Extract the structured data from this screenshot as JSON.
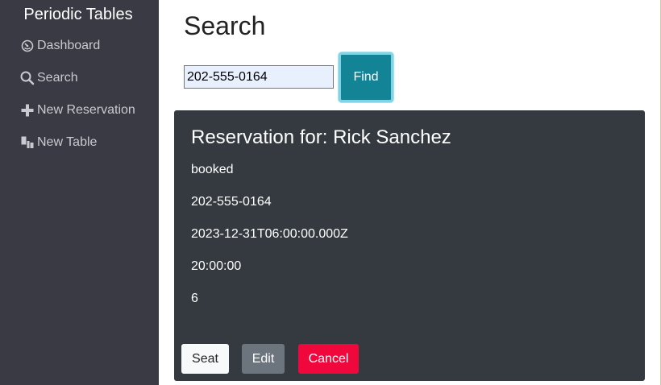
{
  "sidebar": {
    "brand": "Periodic Tables",
    "items": [
      {
        "label": "Dashboard",
        "icon": "dashboard-icon"
      },
      {
        "label": "Search",
        "icon": "search-icon"
      },
      {
        "label": "New Reservation",
        "icon": "plus-icon"
      },
      {
        "label": "New Table",
        "icon": "table-icon"
      }
    ]
  },
  "main": {
    "title": "Search",
    "search": {
      "value": "202-555-0164",
      "button_label": "Find"
    },
    "reservation": {
      "title": "Reservation for: Rick Sanchez",
      "status": "booked",
      "mobile_number": "202-555-0164",
      "date": "2023-12-31T06:00:00.000Z",
      "time": "20:00:00",
      "people": "6",
      "buttons": {
        "seat": "Seat",
        "edit": "Edit",
        "cancel": "Cancel"
      }
    }
  },
  "colors": {
    "sidebar_bg": "#3a3a44",
    "card_bg": "#343a40",
    "find_button": "#138496",
    "cancel_button": "#f0083c",
    "edit_button": "#6c757d"
  }
}
